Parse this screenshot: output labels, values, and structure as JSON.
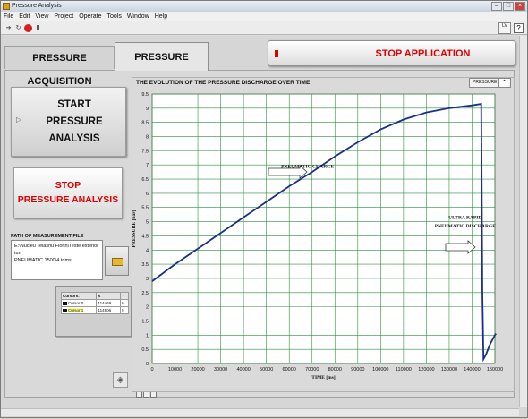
{
  "window": {
    "title": "Pressure Analysis"
  },
  "menu": [
    "File",
    "Edit",
    "View",
    "Project",
    "Operate",
    "Tools",
    "Window",
    "Help"
  ],
  "tabs": {
    "acquisition": "PRESSURE ACQUISITION",
    "analysis": "PRESSURE ANALYSIS"
  },
  "buttons": {
    "stop_application": "STOP APPLICATION",
    "start_analysis": [
      "START",
      "PRESSURE",
      "ANALYSIS"
    ],
    "stop_analysis": [
      "STOP",
      "PRESSURE ANALYSIS"
    ]
  },
  "path": {
    "label": "PATH OF MEASUREMENT FILE",
    "value_lines": [
      "E:\\Nucleu Teiasnu Florin\\Teste exterior tun",
      "PNEUMATIC 1500\\4.tdms"
    ]
  },
  "cursors": {
    "headers": [
      "Cursors:",
      "X",
      "Y"
    ],
    "rows": [
      {
        "name": "Cursor 0",
        "x": "114469",
        "y": "9"
      },
      {
        "name": "Cursor 1",
        "x": "114506",
        "y": "9"
      }
    ]
  },
  "graph_legend": "PRESSURE",
  "chart_data": {
    "type": "line",
    "title": "THE EVOLUTION OF THE PRESSURE DISCHARGE OVER TIME",
    "xlabel": "TIME [ms]",
    "ylabel": "PRESSURE [bar]",
    "xlim": [
      0,
      150000
    ],
    "ylim": [
      0,
      9.5
    ],
    "x_ticks": [
      "0",
      "10000",
      "20000",
      "30000",
      "40000",
      "50000",
      "60000",
      "70000",
      "80000",
      "90000",
      "100000",
      "110000",
      "120000",
      "130000",
      "140000",
      "150000"
    ],
    "y_ticks": [
      "0",
      "0.5",
      "1",
      "1.5",
      "2",
      "2.5",
      "3",
      "3.5",
      "4",
      "4.5",
      "5",
      "5.5",
      "6",
      "6.5",
      "7",
      "7.5",
      "8",
      "8.5",
      "9",
      "9.5"
    ],
    "grid": true,
    "series": [
      {
        "name": "PRESSURE",
        "color": "#1a2f8a",
        "x": [
          0,
          10000,
          20000,
          30000,
          40000,
          50000,
          60000,
          70000,
          80000,
          90000,
          100000,
          110000,
          120000,
          130000,
          140000,
          144000,
          144500,
          145000,
          146000,
          148000,
          150000,
          150500
        ],
        "values": [
          2.9,
          3.5,
          4.05,
          4.6,
          5.15,
          5.7,
          6.25,
          6.75,
          7.3,
          7.8,
          8.25,
          8.6,
          8.85,
          9.0,
          9.1,
          9.15,
          2.5,
          0.15,
          0.3,
          0.7,
          1.0,
          1.05
        ]
      }
    ],
    "annotations": [
      {
        "text": "PNEUMATIC CHARGE",
        "x": 68000,
        "y": 6.9
      },
      {
        "text": "ULTRA RAPID",
        "x": 137000,
        "y": 5.1
      },
      {
        "text": "PNEUMATIC DISCHARGE",
        "x": 137000,
        "y": 4.8
      }
    ]
  }
}
